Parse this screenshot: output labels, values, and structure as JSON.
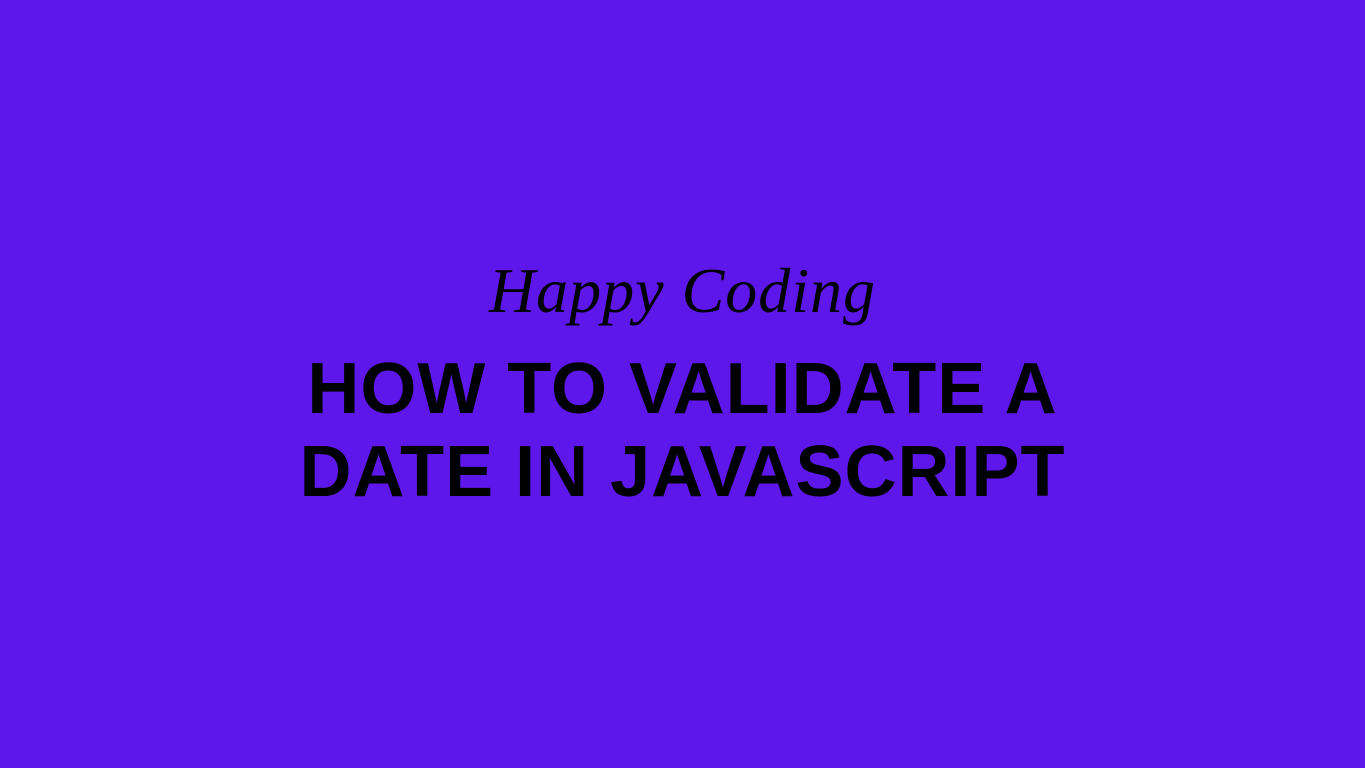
{
  "tagline": "Happy Coding",
  "headline": "HOW TO VALIDATE A DATE IN JAVASCRIPT",
  "colors": {
    "background": "#5e17eb",
    "text": "#000000"
  }
}
